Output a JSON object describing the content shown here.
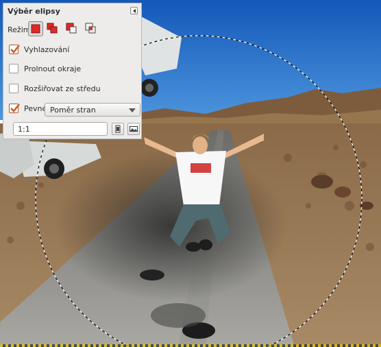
{
  "tool_options": {
    "title": "Výběr elipsy",
    "mode_label": "Režim:",
    "modes": [
      "replace-mode-icon",
      "add-mode-icon",
      "subtract-mode-icon",
      "intersect-mode-icon"
    ],
    "antialiasing_label": "Vyhlazování",
    "antialiasing_checked": true,
    "feather_label": "Prolnout okraje",
    "feather_checked": false,
    "expand_label": "Rozšiřovat ze středu",
    "expand_checked": false,
    "fixed_label": "Pevné:",
    "fixed_checked": true,
    "fixed_option": "Poměr stran",
    "ratio_value": "1:1"
  },
  "colors": {
    "panel_bg": "#edeceb",
    "checkbox_accent": "#c8612a",
    "mode_red": "#e02a2a",
    "sky": "#1f6fcf",
    "road": "#5b5b58"
  }
}
